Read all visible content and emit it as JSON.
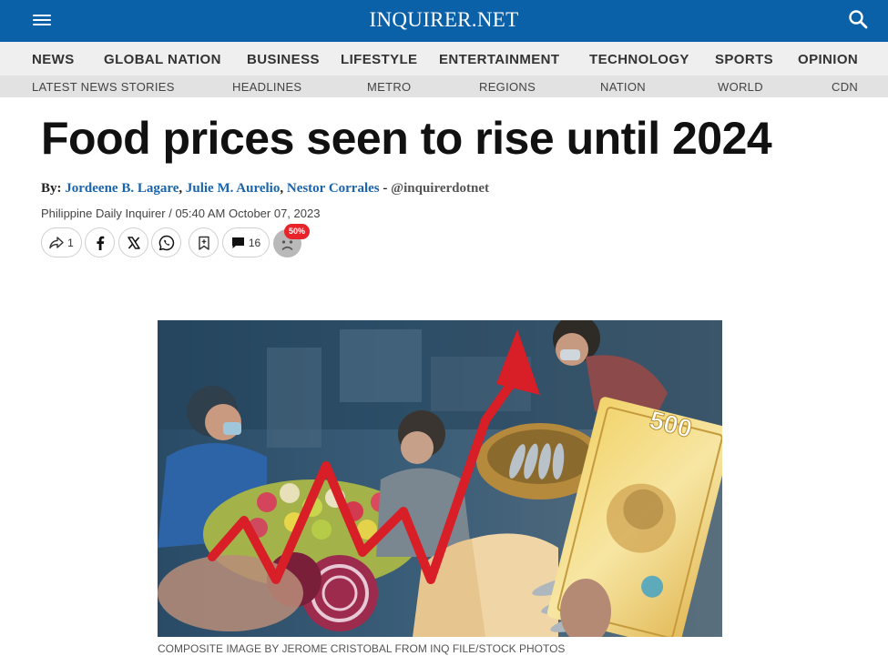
{
  "header": {
    "logo": "INQUIRER.NET",
    "menu_icon": "hamburger-menu-icon",
    "search_icon": "search-icon",
    "bar_color": "#0a61a8"
  },
  "nav_primary": [
    "NEWS",
    "GLOBAL NATION",
    "BUSINESS",
    "LIFESTYLE",
    "ENTERTAINMENT",
    "TECHNOLOGY",
    "SPORTS",
    "OPINION"
  ],
  "nav_secondary": [
    "LATEST NEWS STORIES",
    "HEADLINES",
    "METRO",
    "REGIONS",
    "NATION",
    "WORLD",
    "CDN"
  ],
  "article": {
    "title": "Food prices seen to rise until 2024",
    "byline": {
      "prefix": "By:",
      "authors": [
        "Jordeene B. Lagare",
        "Julie M. Aurelio",
        "Nestor Corrales"
      ],
      "separator": ",",
      "dash": "-",
      "handle": "@inquirerdotnet"
    },
    "publication": "Philippine Daily Inquirer",
    "meta_sep": "/",
    "timestamp": "05:40 AM October 07, 2023",
    "actions": {
      "share_count": "1",
      "comment_count": "16",
      "reaction_badge": "50%"
    },
    "image_caption": "COMPOSITE IMAGE BY JEROME CRISTOBAL FROM INQ FILE/STOCK PHOTOS",
    "image_text": {
      "banknote_value": "500"
    }
  },
  "colors": {
    "link": "#1a64ab",
    "badge": "#e8232a",
    "arrow": "#d81e26"
  }
}
